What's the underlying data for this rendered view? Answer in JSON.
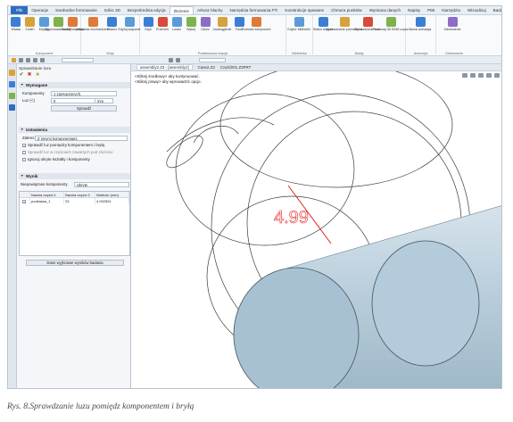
{
  "menu": {
    "tabs": [
      "Plik",
      "Operacje",
      "Swobodne formowanie",
      "Szkic 3D",
      "Bezpośrednia edycja",
      "Złożenie",
      "Arkusz blachy",
      "Narzędzia formowania FTI",
      "Konstrukcje spawane",
      "Chmura punktów",
      "Wymiana danych",
      "Napisy",
      "PMI",
      "Narzędzia",
      "Wizualizuj",
      "Badaj"
    ]
  },
  "ribbon": {
    "groups": [
      {
        "label": "Komponent",
        "buttons": [
          "Wstaw",
          "Zmień",
          "Edycja",
          "Wyprowadź kształt",
          "Zwolnij wiązania"
        ]
      },
      {
        "label": "Wiąż",
        "buttons": [
          "Wiązania mechaniczne",
          "Otwórz",
          "Edytuj wiązanie"
        ]
      },
      {
        "label": "Podstawowa edycja",
        "buttons": [
          "Szyk",
          "Przenieś",
          "Lustro",
          "Wytnij",
          "Otwór",
          "Zaokrąglenie",
          "Faza",
          "Przenieś komponent"
        ]
      },
      {
        "label": "Biblioteka",
        "buttons": [
          "Edytor biblioteki"
        ]
      },
      {
        "label": "Badaj",
        "buttons": [
          "Status wiązań",
          "Sprawdzanie przenikania",
          "Sprawdzanie luzu",
          "Porównaj 3D BOM części"
        ]
      },
      {
        "label": "Animacja",
        "buttons": [
          "Nowa animacja"
        ]
      },
      {
        "label": "Odniesienie",
        "buttons": [
          "Odniesienie"
        ]
      }
    ]
  },
  "panel": {
    "title": "Sprawdzanie luzu",
    "section_required": "Wymagane",
    "components_label": "Komponenty",
    "components_value": "1 zaznaczonych,",
    "clearance_label": "Luz (<)",
    "clearance_value": "0",
    "clearance_unit": "mm",
    "check_button": "Sprawdź",
    "section_settings": "Ustawienia",
    "scope_label": "Zakres",
    "scope_value": "Z innymi komponentami",
    "opt1": "Sprawdź luz pomiędzy komponentem i bryłą",
    "opt2": "Sprawdź luz w częściach zawartych pod złożenie",
    "opt3": "Ignoruj ukryte kształty i komponenty",
    "section_result": "Wynik",
    "filter_label": "Niepowiązane komponenty",
    "filter_value": "Ukryte",
    "table": {
      "headers": [
        "Nazwa części 1",
        "Nazwa części 2",
        "Wartość (mm)"
      ],
      "rows": [
        [
          "podstawa_1",
          "S1",
          "4.092551"
        ]
      ]
    },
    "export_button": "Dane wyjściowe wyników badania"
  },
  "doc_tabs": [
    "assembly2.Z3 - [assembly2]",
    "Case2.Z3",
    "Część001.Z3PRT"
  ],
  "viewport": {
    "hint1": "<Kliknij środkowy> aby kontynuować.",
    "hint2": "<Kliknij prawy> aby wprowadzić opcje.",
    "dimension": "4.99"
  },
  "caption": "Rys. 8.Sprawdzanie luzu pomiędz komponentem i bryłą"
}
